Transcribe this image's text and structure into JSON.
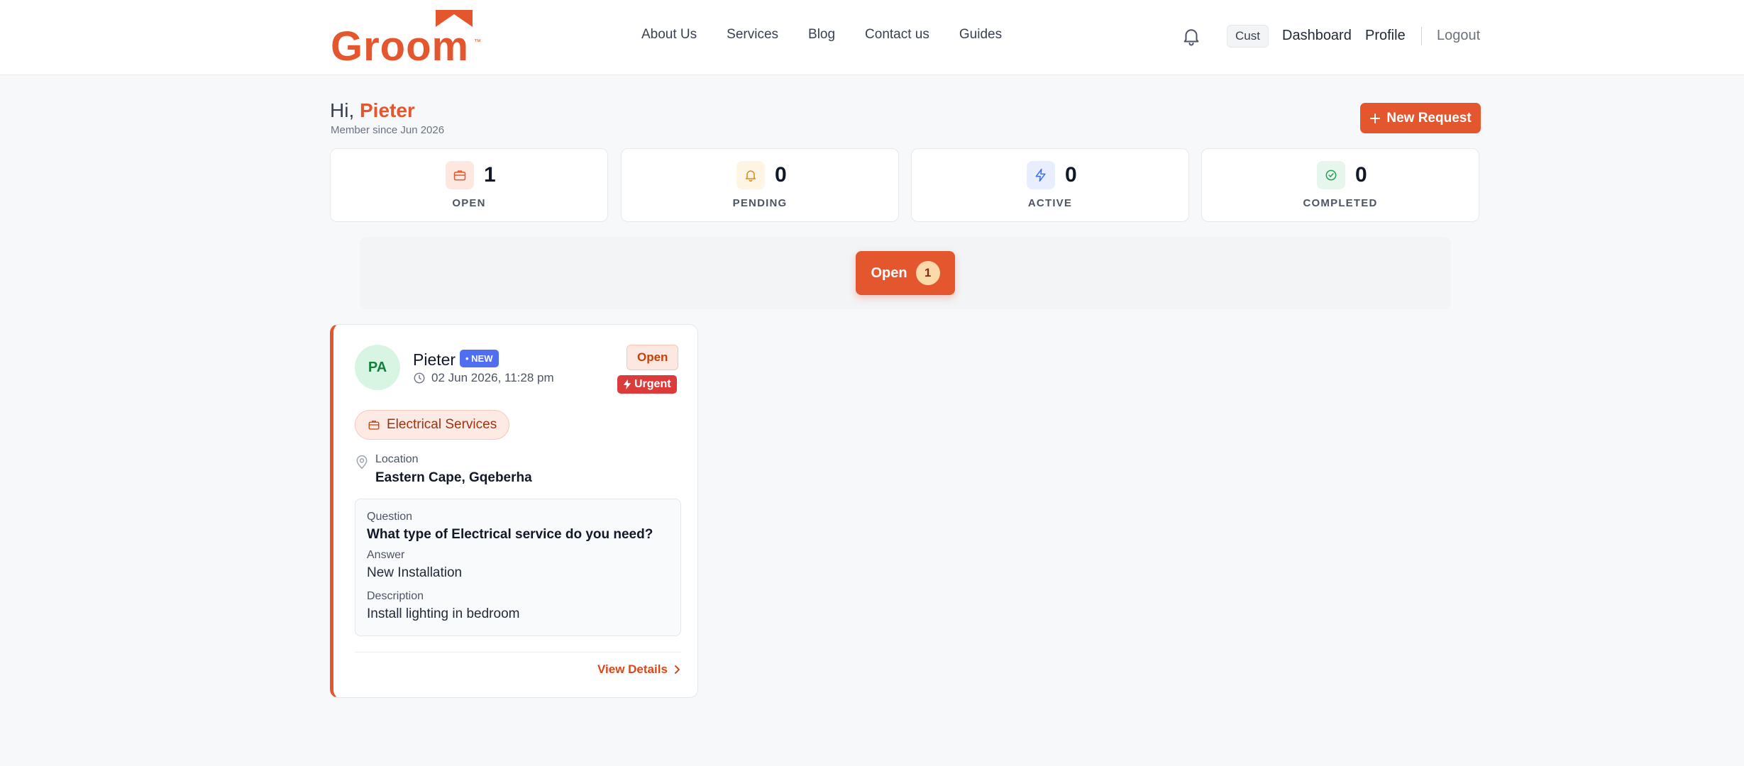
{
  "header": {
    "logo_text": "Groom",
    "logo_tm": "™",
    "nav": [
      "About Us",
      "Services",
      "Blog",
      "Contact us",
      "Guides"
    ],
    "role_badge": "Cust",
    "dashboard": "Dashboard",
    "profile": "Profile",
    "logout": "Logout"
  },
  "greeting": {
    "prefix": "Hi, ",
    "name": "Pieter",
    "member_since": "Member since Jun 2026"
  },
  "new_request_label": "New Request",
  "stats": [
    {
      "value": "1",
      "label": "OPEN",
      "icon": "briefcase-icon"
    },
    {
      "value": "0",
      "label": "PENDING",
      "icon": "bell-icon"
    },
    {
      "value": "0",
      "label": "ACTIVE",
      "icon": "bolt-icon"
    },
    {
      "value": "0",
      "label": "COMPLETED",
      "icon": "check-circle-icon"
    }
  ],
  "filter": {
    "label": "Open",
    "count": "1"
  },
  "request": {
    "initials": "PA",
    "name": "Pieter",
    "new_badge": "• NEW",
    "date": "02 Jun 2026, 11:28 pm",
    "status": "Open",
    "urgent": "Urgent",
    "category": "Electrical Services",
    "location_label": "Location",
    "location_value": "Eastern Cape, Gqeberha",
    "question_label": "Question",
    "question": "What type of Electrical service do you need?",
    "answer_label": "Answer",
    "answer": "New Installation",
    "description_label": "Description",
    "description": "Install lighting in bedroom",
    "view_details": "View Details"
  },
  "colors": {
    "brand": "#e4572e",
    "new_badge": "#4f6ef2",
    "urgent": "#dc3b3b"
  }
}
